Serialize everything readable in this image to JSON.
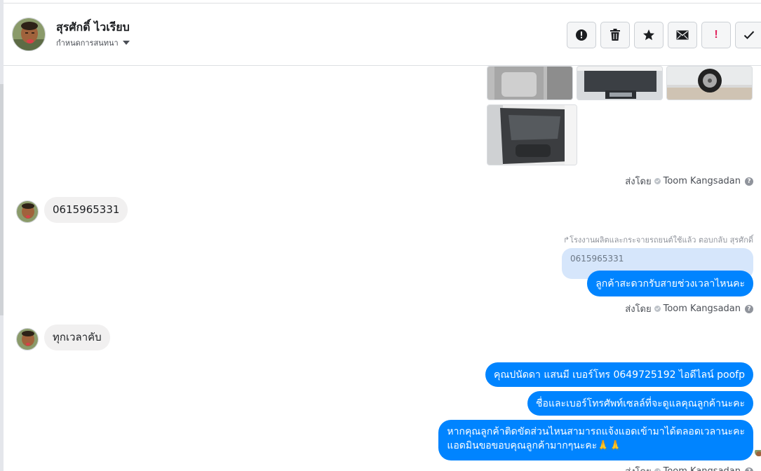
{
  "header": {
    "contact_name": "สุรศักดิ์ ไวเรียบ",
    "conversation_settings": "กำหนดการสนทนา",
    "toolbar": [
      {
        "icon": "alert-circle-icon",
        "name": "mark-spam-button"
      },
      {
        "icon": "trash-icon",
        "name": "delete-button"
      },
      {
        "icon": "star-icon",
        "name": "star-button"
      },
      {
        "icon": "envelope-icon",
        "name": "mark-unread-button"
      },
      {
        "icon": "exclamation-icon",
        "name": "follow-up-button",
        "glyph": "!"
      },
      {
        "icon": "checkmark-icon",
        "name": "done-button"
      }
    ]
  },
  "colors": {
    "outgoing_bubble": "#0084ff",
    "incoming_bubble": "#f1f0f0",
    "quoted_bubble": "#d6e6fb",
    "meta_text": "#90949c"
  },
  "messages": {
    "sent_by_label": "ส่งโดย",
    "sender_name": "Toom Kangsadan",
    "help_glyph": "?",
    "incoming_1": "0615965331",
    "reply_meta": "โรงงานผลิตและกระจายรถยนต์ใช้แล้ว ตอบกลับ สุรศักดิ์",
    "quoted_text": "0615965331",
    "outgoing_1": "ลูกค้าสะดวกรับสายช่วงเวลาไหนคะ",
    "incoming_2": "ทุกเวลาคับ",
    "outgoing_2": "คุณปนัดดา แสนมี   เบอร์โทร 0649725192  ไอดีไลน์ poofp",
    "outgoing_3": "ชื่อและเบอร์โทรศัพท์เซลล์ที่จะดูแลคุณลูกค้านะคะ",
    "outgoing_4_line1": "หากคุณลูกค้าติดขัดส่วนไหนสามารถแจ้งแอดเข้ามาได้ตลอดเวลานะคะ",
    "outgoing_4_line2": "แอดมินขอขอบคุณลูกค้ามากๆนะคะ🙏🙏"
  }
}
